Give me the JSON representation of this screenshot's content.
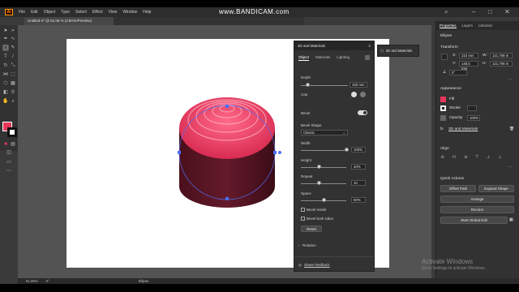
{
  "watermark": "www.BANDICAM.com",
  "menubar": {
    "logo": "Ai",
    "items": [
      "File",
      "Edit",
      "Object",
      "Type",
      "Select",
      "Effect",
      "View",
      "Window",
      "Help"
    ]
  },
  "document_tab": "Untitled-2* @ 51.06 % (CMYK/Preview)",
  "panel3d": {
    "title": "3D and Materials",
    "tabs": [
      "Object",
      "Materials",
      "Lighting"
    ],
    "depth_label": "Depth",
    "depth_value": "100 mm",
    "depth_fraction": 0.15,
    "cap_label": "Cap",
    "bevel_label": "Bevel",
    "bevel_on": true,
    "bevel_shape_label": "Bevel Shape",
    "bevel_shape_value": "Classic",
    "width_label": "Width",
    "width_value": "100%",
    "width_fraction": 1.0,
    "height_label": "Height",
    "height_value": "40%",
    "height_fraction": 0.4,
    "repeat_label": "Repeat",
    "repeat_value": "10",
    "repeat_fraction": 0.4,
    "space_label": "Space",
    "space_value": "50%",
    "space_fraction": 0.5,
    "bevel_inside": "Bevel Inside",
    "bevel_both_sides": "Bevel both sides",
    "reset": "Reset",
    "rotation": "Rotation",
    "share_feedback": "Share feedback"
  },
  "flyout": {
    "label": "3D and Materials"
  },
  "props": {
    "tabs": [
      "Properties",
      "Layers",
      "Libraries"
    ],
    "object_type": "Ellipse",
    "transform_label": "Transform",
    "x": "210 mm",
    "y": "148,5 mm",
    "w": "121,708 m",
    "h": "121,708 m",
    "angle": "0°",
    "appearance_label": "Appearance",
    "fill_label": "Fill",
    "stroke_label": "Stroke",
    "opacity_label": "Opacity",
    "opacity_value": "100%",
    "effect_label": "3D and Materials",
    "align_label": "Align",
    "quick_actions_label": "Quick Actions",
    "offset_path": "Offset Path",
    "expand_shape": "Expand Shape",
    "arrange": "Arrange",
    "recolor": "Recolor",
    "global_edit": "Start Global Edit"
  },
  "status": {
    "zoom": "51,06%",
    "angle": "0°",
    "tool": "Ellipse"
  },
  "activate": {
    "title": "Activate Windows",
    "subtitle": "Go to Settings to activate Windows."
  },
  "colors": {
    "fill": "#e8365a",
    "shape_top": "#e84a6a",
    "shape_side": "#5a1424",
    "selection": "#4c6ef5"
  }
}
